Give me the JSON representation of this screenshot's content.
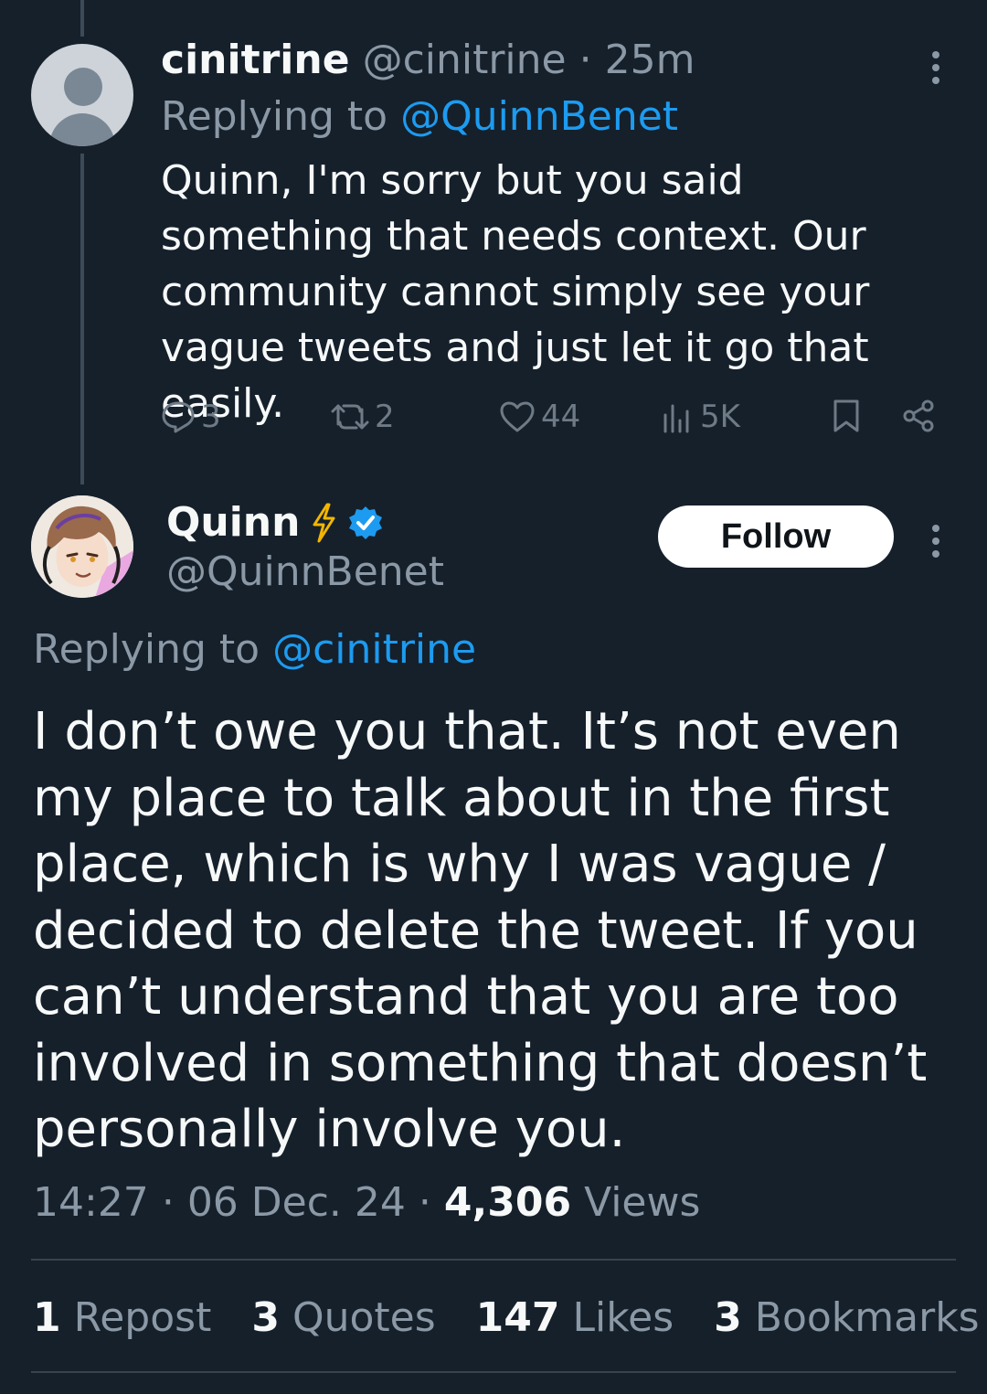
{
  "reply_tweet": {
    "display_name": "cinitrine",
    "handle": "@cinitrine",
    "separator": "·",
    "time_ago": "25m",
    "replying_to_prefix": "Replying to",
    "replying_to_handle": "@QuinnBenet",
    "text": "Quinn, I'm sorry but you said something that needs context. Our community cannot simply see your vague tweets and just let it go that easily.",
    "actions": {
      "replies": "3",
      "reposts": "2",
      "likes": "44",
      "views": "5K"
    },
    "icons": [
      "reply-icon",
      "repost-icon",
      "like-icon",
      "views-icon",
      "bookmark-icon",
      "share-icon",
      "more-icon"
    ]
  },
  "main_tweet": {
    "display_name": "Quinn",
    "handle": "@QuinnBenet",
    "verified": true,
    "follow_label": "Follow",
    "replying_to_prefix": "Replying to",
    "replying_to_handle": "@cinitrine",
    "text": "I don’t owe you that. It’s not even my place to talk about in the first place, which is why I was vague / decided to delete the tweet. If you can’t understand that you are too involved in something that doesn’t personally involve you.",
    "time": "14:27",
    "date": "06 Dec. 24",
    "separator": "·",
    "views_count": "4,306",
    "views_label": "Views",
    "stats": [
      {
        "count": "1",
        "label": "Repost"
      },
      {
        "count": "3",
        "label": "Quotes"
      },
      {
        "count": "147",
        "label": "Likes"
      },
      {
        "count": "3",
        "label": "Bookmarks"
      }
    ]
  },
  "colors": {
    "background": "#15202b",
    "text": "#f7f9f9",
    "muted": "#8b98a5",
    "link": "#1d9bf0",
    "lightning": "#f2b600",
    "divider": "#38444d"
  }
}
